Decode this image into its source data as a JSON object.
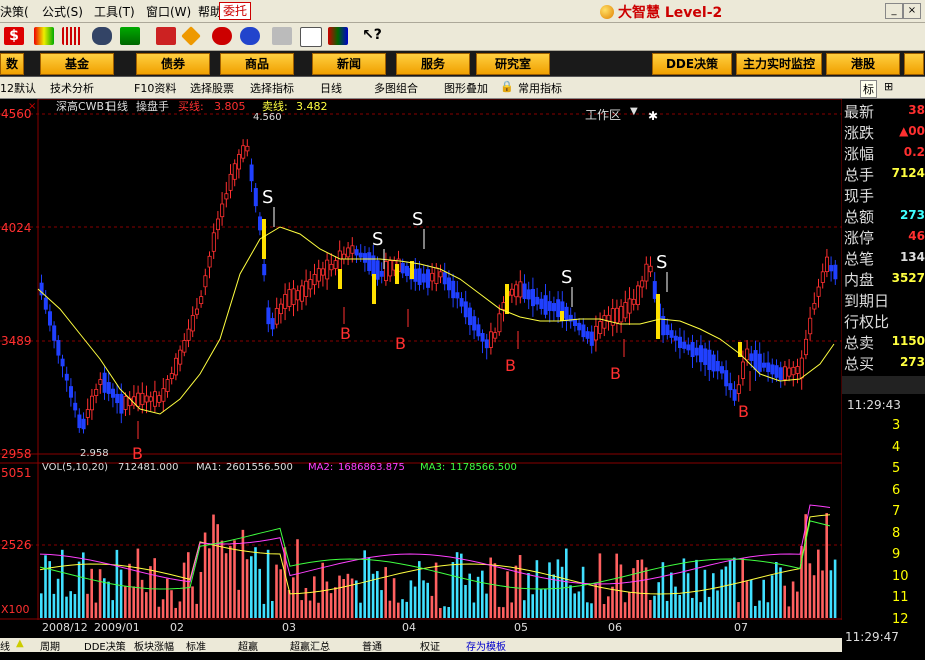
{
  "menubar": {
    "items": [
      "決策(",
      "公式(S)",
      "工具(T)",
      "窗口(W)",
      "帮助(H)"
    ],
    "entrust": "委托",
    "brand": "大智慧 Level-2"
  },
  "navbar": {
    "buttons": [
      "数",
      "基金",
      "债券",
      "商品",
      "新闻",
      "服务",
      "研究室"
    ],
    "workspace": "工作区",
    "right_buttons": [
      "DDE决策",
      "主力实时监控",
      "港股"
    ]
  },
  "subbar": {
    "items": [
      "12默认",
      "技术分析",
      "F10资料",
      "选择股票",
      "选择指标",
      "日线",
      "多图组合",
      "图形叠加",
      "常用指标"
    ],
    "right_items": [
      "标",
      "⊞"
    ]
  },
  "chart": {
    "title_bar": {
      "name": "深高CWB1",
      "period": "日线",
      "tool": "操盘手",
      "buy_line_label": "买线:",
      "buy_line_value": "3.805",
      "sell_line_label": "卖线:",
      "sell_line_value": "3.482"
    },
    "price_axis": [
      "4560",
      "4024",
      "3489",
      "2958"
    ],
    "high_marker": "4.560",
    "low_marker": "2.958",
    "vol_axis": [
      "5051",
      "2526",
      "X100"
    ],
    "vol_title": "VOL(5,10,20)",
    "vol_value": "712481.000",
    "ma1_label": "MA1:",
    "ma1_value": "2601556.500",
    "ma2_label": "MA2:",
    "ma2_value": "1686863.875",
    "ma3_label": "MA3:",
    "ma3_value": "1178566.500",
    "date_axis": [
      "2008/12",
      "2009/01",
      "02",
      "03",
      "04",
      "05",
      "06",
      "07"
    ],
    "signals_s": [
      "S",
      "S",
      "S",
      "S",
      "S"
    ],
    "signals_b": [
      "B",
      "B",
      "B",
      "B",
      "B",
      "B",
      "B"
    ]
  },
  "right_panel": {
    "rows": [
      {
        "label": "最新",
        "value": "38"
      },
      {
        "label": "涨跌",
        "value": "▲00"
      },
      {
        "label": "涨幅",
        "value": "0.2"
      },
      {
        "label": "总手",
        "value": "7124"
      },
      {
        "label": "现手",
        "value": ""
      },
      {
        "label": "总额",
        "value": "273"
      },
      {
        "label": "涨停",
        "value": "46"
      },
      {
        "label": "总笔",
        "value": "134"
      },
      {
        "label": "内盘",
        "value": "3527"
      },
      {
        "label": "到期日",
        "value": ""
      },
      {
        "label": "行权比",
        "value": ""
      },
      {
        "label": "总卖",
        "value": "1150"
      },
      {
        "label": "总买",
        "value": "273"
      }
    ],
    "time1": "11:29:43",
    "numbers": [
      "3",
      "4",
      "5",
      "6",
      "7",
      "8",
      "9",
      "10",
      "11",
      "12"
    ],
    "time2": "11:29:47"
  },
  "bottom_tabs": [
    "线",
    "▲",
    "层",
    "周期",
    "DDE决策",
    "板块涨幅",
    "标准",
    "超赢",
    "超赢汇总",
    "普通",
    "权证",
    "存为模板"
  ],
  "colors": {
    "up": "#ff3030",
    "down": "#2040ff",
    "ma_yellow": "#ffff40",
    "grid_red": "#801010"
  }
}
